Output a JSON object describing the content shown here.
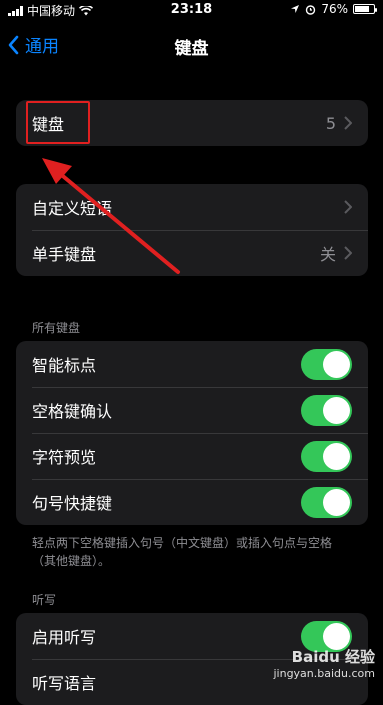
{
  "status_bar": {
    "carrier": "中国移动",
    "time": "23:18",
    "battery": "76%",
    "battery_level": 0.76
  },
  "nav": {
    "back_label": "通用",
    "title": "键盘"
  },
  "keyboards_row": {
    "label": "键盘",
    "value": "5"
  },
  "group2": [
    {
      "label": "自定义短语",
      "value": ""
    },
    {
      "label": "单手键盘",
      "value": "关"
    }
  ],
  "all_keyboards": {
    "header": "所有键盘",
    "items": [
      {
        "label": "智能标点",
        "on": true
      },
      {
        "label": "空格键确认",
        "on": true
      },
      {
        "label": "字符预览",
        "on": true
      },
      {
        "label": "句号快捷键",
        "on": true
      }
    ],
    "footer": "轻点两下空格键插入句号（中文键盘）或插入句点与空格（其他键盘）。"
  },
  "dictation": {
    "header": "听写",
    "items": [
      {
        "label": "启用听写",
        "on": true
      },
      {
        "label": "听写语言"
      }
    ]
  },
  "watermark": {
    "brand": "Baidu 经验",
    "url": "jingyan.baidu.com"
  },
  "colors": {
    "accent": "#0a84ff",
    "toggle_on": "#34c759",
    "annotation": "#e02020"
  }
}
